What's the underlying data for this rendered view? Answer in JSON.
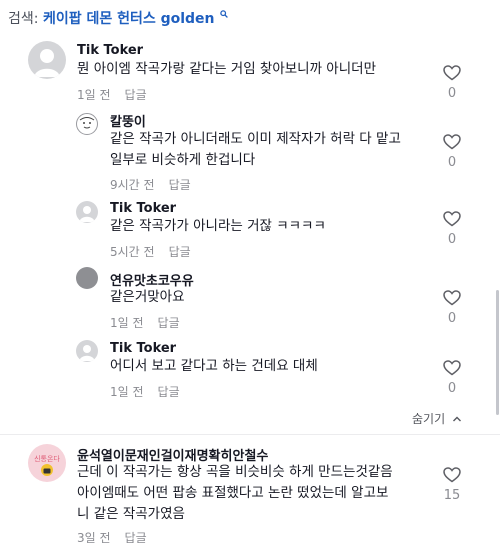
{
  "search": {
    "prefix": "검색:",
    "query": "케이팝 데몬 헌터스 golden"
  },
  "comments": [
    {
      "username": "Tik Toker",
      "lines": [
        "뭔 아이엠 작곡가랑 같다는 거임 찾아보니까 아니더만"
      ],
      "time": "1일 전",
      "reply": "답글",
      "likes": "0"
    },
    {
      "username": "칼뚱이",
      "lines": [
        "같은 작곡가 아니더래도 이미 제작자가 허락 다 맡고",
        "일부로 비슷하게 한겁니다"
      ],
      "time": "9시간 전",
      "reply": "답글",
      "likes": "0"
    },
    {
      "username": "Tik Toker",
      "lines": [
        "같은 작곡가가 아니라는 거잖 ㅋㅋㅋㅋ"
      ],
      "time": "5시간 전",
      "reply": "답글",
      "likes": "0"
    },
    {
      "username": "연유맛초코우유",
      "lines": [
        "같은거맞아요"
      ],
      "time": "1일 전",
      "reply": "답글",
      "likes": "0"
    },
    {
      "username": "Tik Toker",
      "lines": [
        "어디서 보고 같다고 하는 건데요 대체"
      ],
      "time": "1일 전",
      "reply": "답글",
      "likes": "0"
    },
    {
      "username": "윤석열이문재인걸이재명확히안철수",
      "avatar_text": "신통온다",
      "lines": [
        "근데 이 작곡가는 항상 곡을 비슷비슷 하게 만드는것같음",
        "아이엠때도 어떤 팝송 표절했다고 논란 떴었는데 알고보",
        "니 같은 작곡가였음"
      ],
      "time": "3일 전",
      "reply": "답글",
      "likes": "15"
    }
  ],
  "hide_replies": "숨기기",
  "colors": {
    "query": "#1f5fbf",
    "meta": "#8a8b91"
  }
}
